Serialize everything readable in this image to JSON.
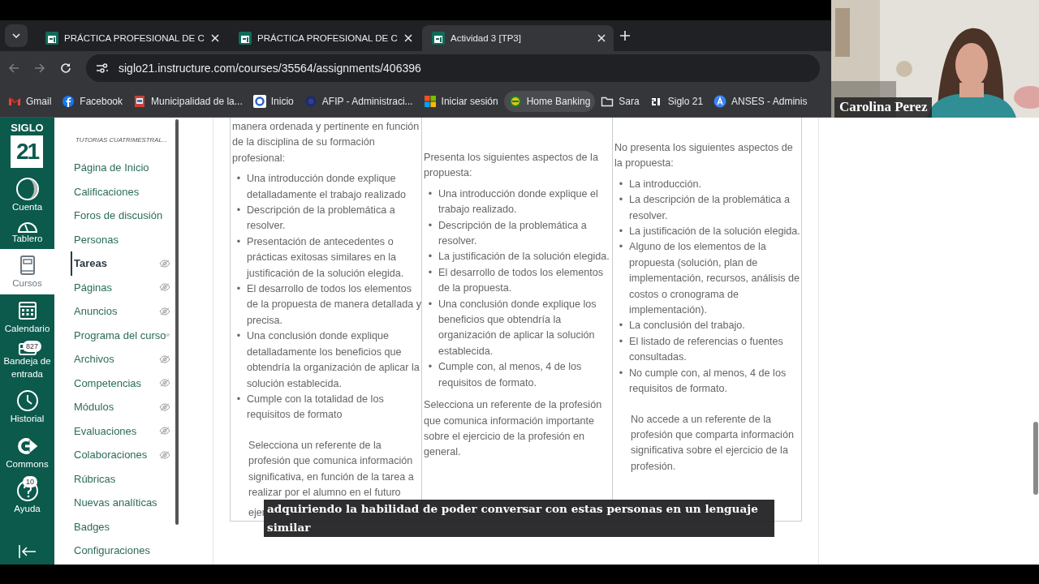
{
  "browser": {
    "tabs": [
      {
        "title": "PRÁCTICA PROFESIONAL DE C",
        "selected": false
      },
      {
        "title": "PRÁCTICA PROFESIONAL DE C",
        "selected": false
      },
      {
        "title": "Actividad 3 [TP3]",
        "selected": true
      }
    ],
    "address": "siglo21.instructure.com/courses/35564/assignments/406396",
    "bookmarks": [
      {
        "label": "Gmail",
        "kind": "gmail"
      },
      {
        "label": "Facebook",
        "kind": "facebook"
      },
      {
        "label": "Municipalidad de la...",
        "kind": "crest"
      },
      {
        "label": "Inicio",
        "kind": "ring"
      },
      {
        "label": "AFIP - Administraci...",
        "kind": "seal"
      },
      {
        "label": "Iniciar sesión",
        "kind": "windows"
      },
      {
        "label": "Home Banking",
        "kind": "link",
        "selected": true
      },
      {
        "label": "Sara",
        "kind": "folder"
      },
      {
        "label": "Siglo 21",
        "kind": "siglo"
      },
      {
        "label": "ANSES - Adminis",
        "kind": "letter"
      }
    ]
  },
  "video": {
    "name": "Carolina Perez"
  },
  "global_nav": {
    "logo_top": "SIGLO",
    "logo_mark": "21",
    "items": [
      {
        "label": "Cuenta",
        "kind": "avatar",
        "selected": false
      },
      {
        "label": "Tablero",
        "kind": "gauge",
        "selected": false
      },
      {
        "label": "Cursos",
        "kind": "book",
        "selected": true
      },
      {
        "label": "Calendario",
        "kind": "calendar",
        "selected": false
      },
      {
        "label": "Bandeja de entrada",
        "kind": "inbox",
        "selected": false,
        "badge": "827"
      },
      {
        "label": "Historial",
        "kind": "clock",
        "selected": false
      },
      {
        "label": "Commons",
        "kind": "commons",
        "selected": false
      },
      {
        "label": "Ayuda",
        "kind": "help",
        "selected": false,
        "badge": "10"
      }
    ]
  },
  "course_nav": {
    "heading": "TUTORIAS CUATRIMESTRAL...",
    "items": [
      {
        "label": "Página de Inicio",
        "selected": false,
        "hidden": false
      },
      {
        "label": "Calificaciones",
        "selected": false,
        "hidden": false
      },
      {
        "label": "Foros de discusión",
        "selected": false,
        "hidden": false
      },
      {
        "label": "Personas",
        "selected": false,
        "hidden": false
      },
      {
        "label": "Tareas",
        "selected": true,
        "hidden": true
      },
      {
        "label": "Páginas",
        "selected": false,
        "hidden": true
      },
      {
        "label": "Anuncios",
        "selected": false,
        "hidden": true
      },
      {
        "label": "Programa del curso",
        "selected": false,
        "hidden": true
      },
      {
        "label": "Archivos",
        "selected": false,
        "hidden": true
      },
      {
        "label": "Competencias",
        "selected": false,
        "hidden": true
      },
      {
        "label": "Módulos",
        "selected": false,
        "hidden": true
      },
      {
        "label": "Evaluaciones",
        "selected": false,
        "hidden": true
      },
      {
        "label": "Colaboraciones",
        "selected": false,
        "hidden": true
      },
      {
        "label": "Rúbricas",
        "selected": false,
        "hidden": false
      },
      {
        "label": "Nuevas analíticas",
        "selected": false,
        "hidden": false
      },
      {
        "label": "Badges",
        "selected": false,
        "hidden": false
      },
      {
        "label": "Configuraciones",
        "selected": false,
        "hidden": false
      }
    ]
  },
  "rubric": {
    "bullet": "•",
    "columns": [
      {
        "intro": "manera ordenada y pertinente en función de la disciplina de su formación profesional:",
        "items": [
          "Una introducción donde explique detalladamente el trabajo realizado",
          "Descripción de la problemática a resolver.",
          "Presentación de antecedentes o prácticas exitosas similares en la justificación de la solución elegida.",
          "El desarrollo de todos los elementos de la propuesta de manera detallada y precisa.",
          "Una conclusión donde explique detalladamente los beneficios que obtendría la organización de aplicar la solución establecida.",
          "Cumple con la totalidad de los requisitos de formato"
        ],
        "closing": "Selecciona un referente de la profesión que comunica información significativa, en función de la tarea a realizar por el alumno en el futuro",
        "closing_cut": "ejer",
        "closing_indented": true
      },
      {
        "intro": "Presenta los siguientes aspectos de la propuesta:",
        "items": [
          "Una introducción donde explique el trabajo realizado.",
          "Descripción de la problemática a resolver.",
          "La justificación de la solución elegida.",
          "El desarrollo de todos los elementos de la propuesta.",
          "Una conclusión donde explique los beneficios que obtendría la organización de aplicar la solución establecida.",
          "Cumple con, al menos, 4 de los requisitos de formato."
        ],
        "closing": "Selecciona un referente de la profesión que comunica información importante sobre el ejercicio de la profesión en general.",
        "closing_indented": false
      },
      {
        "intro": "No presenta los siguientes aspectos de la propuesta:",
        "items": [
          "La introducción.",
          "La descripción de la problemática a resolver.",
          "La justificación de la solución elegida.",
          "Alguno de los elementos de la propuesta (solución, plan de implementación, recursos, análisis de costos o cronograma de implementación).",
          "La conclusión del trabajo.",
          "El listado de referencias o fuentes consultadas.",
          "No cumple con, al menos, 4 de los requisitos de formato."
        ],
        "closing": "No accede a un referente de la profesión que comparta información significativa sobre el ejercicio de la profesión.",
        "closing_indented": true
      }
    ]
  },
  "caption": "adquiriendo la habilidad de poder conversar con estas personas en un lenguaje similar"
}
